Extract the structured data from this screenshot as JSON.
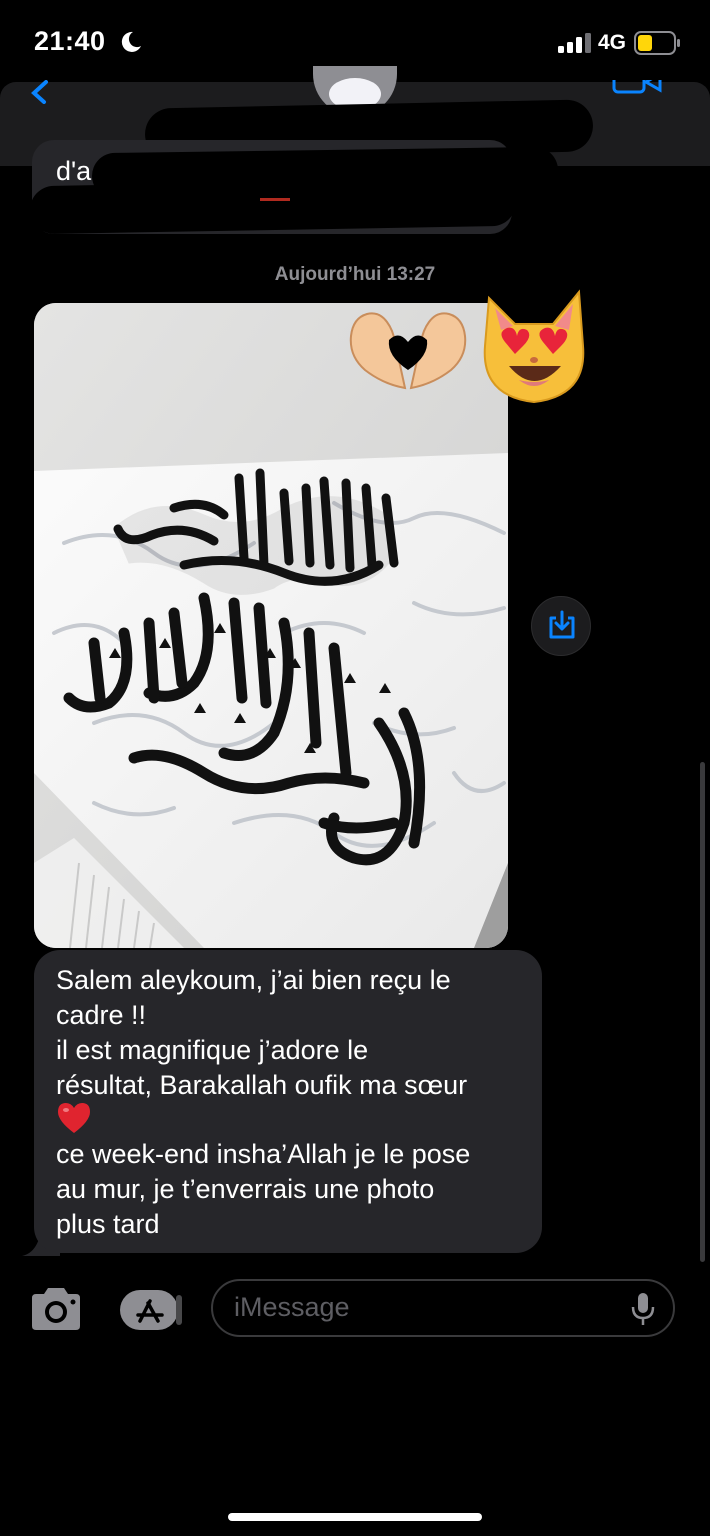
{
  "status_bar": {
    "time": "21:40",
    "network": "4G",
    "battery_color": "#ffd60a"
  },
  "conversation": {
    "previous_snippet": "d'a",
    "timestamp": "Aujourd’hui 13:27",
    "reactions": [
      "heart-hands-icon",
      "heart-eyes-cat-icon"
    ],
    "message_lines": [
      "Salem aleykoum, j’ai bien reçu le",
      "cadre !!",
      "il est magnifique j’adore le",
      "résultat, Barakallah oufik ma sœur",
      "",
      "ce week-end insha’Allah je le pose",
      "au mur, je t’enverrais une photo",
      "plus tard"
    ]
  },
  "input_bar": {
    "placeholder": "iMessage"
  },
  "colors": {
    "accent": "#0a84ff",
    "bubble": "#26262a",
    "background": "#000000"
  }
}
